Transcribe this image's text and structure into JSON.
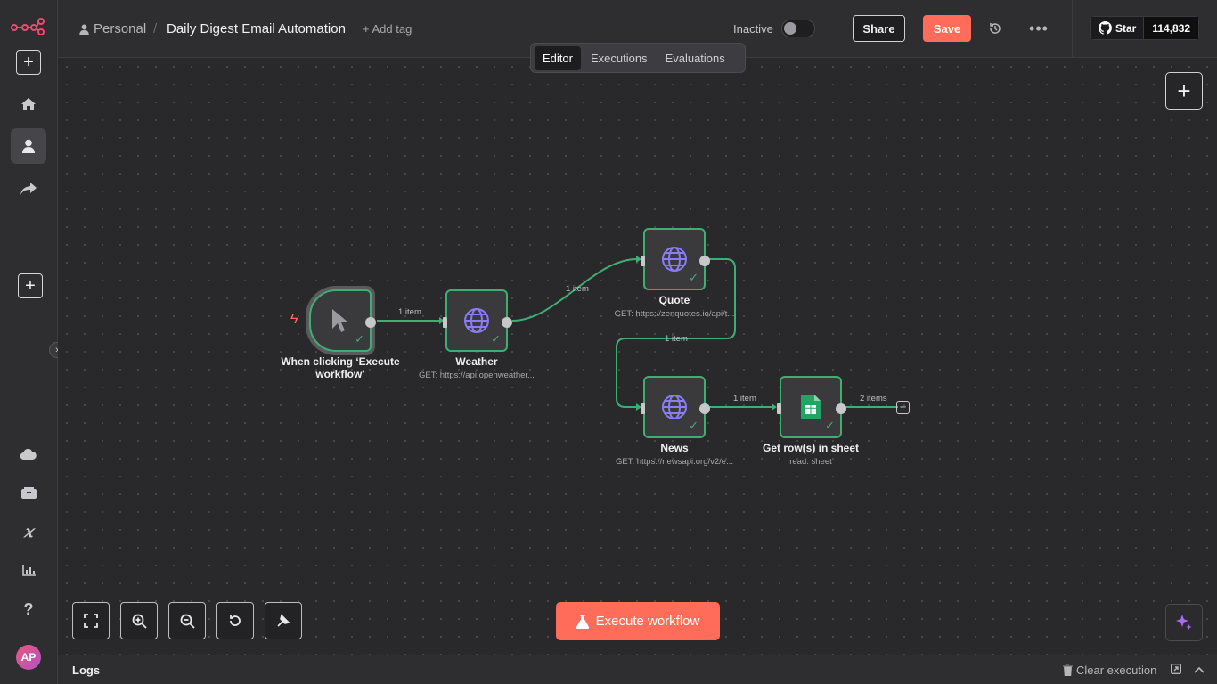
{
  "header": {
    "owner": "Personal",
    "separator": "/",
    "workflow_name": "Daily Digest Email Automation",
    "add_tag": "+ Add tag",
    "status_label": "Inactive",
    "share_label": "Share",
    "save_label": "Save",
    "github": {
      "star_label": "Star",
      "count": "114,832"
    }
  },
  "tabs": [
    {
      "label": "Editor",
      "active": true
    },
    {
      "label": "Executions",
      "active": false
    },
    {
      "label": "Evaluations",
      "active": false
    }
  ],
  "sidebar": {
    "items": [
      {
        "icon": "n8n-logo-icon"
      },
      {
        "icon": "plus-icon"
      },
      {
        "icon": "home-icon"
      },
      {
        "icon": "person-icon",
        "active": true
      },
      {
        "icon": "share-icon"
      },
      {
        "icon": "plus-icon"
      },
      {
        "icon": "cloud-icon"
      },
      {
        "icon": "templates-icon"
      },
      {
        "icon": "variables-icon"
      },
      {
        "icon": "insights-icon"
      },
      {
        "icon": "help-icon"
      }
    ],
    "avatar_initials": "AP"
  },
  "nodes": [
    {
      "id": "trigger",
      "title": "When clicking ‘Execute workflow’",
      "subtitle": ""
    },
    {
      "id": "weather",
      "title": "Weather",
      "subtitle": "GET: https://api.openweather..."
    },
    {
      "id": "quote",
      "title": "Quote",
      "subtitle": "GET: https://zenquotes.io/api/t..."
    },
    {
      "id": "news",
      "title": "News",
      "subtitle": "GET: https://newsapi.org/v2/e..."
    },
    {
      "id": "sheet",
      "title": "Get row(s) in sheet",
      "subtitle": "read: sheet"
    }
  ],
  "edges": [
    {
      "from": "trigger",
      "to": "weather",
      "label": "1 item"
    },
    {
      "from": "weather",
      "to": "quote",
      "label": "1 item"
    },
    {
      "from": "quote",
      "to": "news",
      "label": "1 item"
    },
    {
      "from": "news",
      "to": "sheet",
      "label": "1 item"
    },
    {
      "from": "sheet",
      "to": "end",
      "label": "2 items"
    }
  ],
  "execute_label": "Execute workflow",
  "logs": {
    "title": "Logs",
    "clear_label": "Clear execution"
  },
  "colors": {
    "accent": "#ff6d5a",
    "success": "#3fae73",
    "globe": "#8b7cf6",
    "sheets": "#21a464"
  }
}
